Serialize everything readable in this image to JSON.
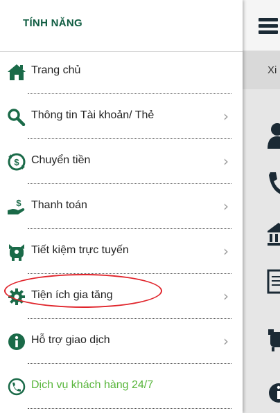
{
  "drawer": {
    "title": "TÍNH NĂNG",
    "items": [
      {
        "label": "Trang chủ",
        "icon": "home-icon",
        "chevron": ""
      },
      {
        "label": "Thông tin Tài khoản/ Thẻ",
        "icon": "search-icon",
        "chevron": "›"
      },
      {
        "label": "Chuyển tiền",
        "icon": "money-transfer-icon",
        "chevron": "›"
      },
      {
        "label": "Thanh toán",
        "icon": "payment-hand-icon",
        "chevron": "›"
      },
      {
        "label": "Tiết kiệm trực tuyến",
        "icon": "piggy-bank-icon",
        "chevron": "›"
      },
      {
        "label": "Tiện ích gia tăng",
        "icon": "gear-icon",
        "chevron": "›"
      },
      {
        "label": "Hỗ trợ giao dịch",
        "icon": "info-icon",
        "chevron": "›"
      },
      {
        "label": "Dịch vụ khách hàng 24/7",
        "icon": "phone-support-icon",
        "chevron": ""
      }
    ]
  },
  "background": {
    "subheader_text": "Xi"
  },
  "colors": {
    "title_green": "#0f5c41",
    "icon_green": "#1a6a48",
    "accent_light_green": "#57b53a",
    "highlight_red": "#e0242b"
  }
}
